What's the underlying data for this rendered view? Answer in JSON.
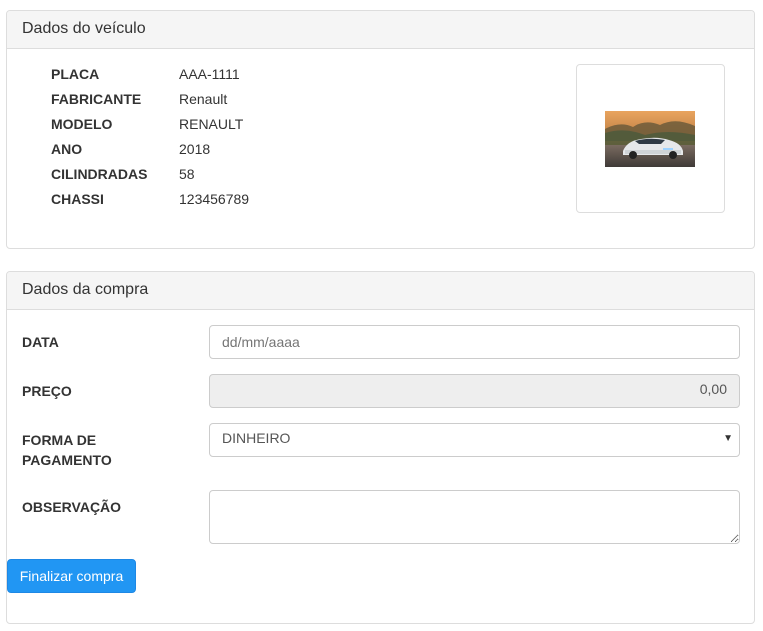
{
  "vehicle": {
    "heading": "Dados do veículo",
    "fields": [
      {
        "label": "PLACA",
        "value": "AAA-1111"
      },
      {
        "label": "FABRICANTE",
        "value": "Renault"
      },
      {
        "label": "MODELO",
        "value": "RENAULT"
      },
      {
        "label": "ANO",
        "value": "2018"
      },
      {
        "label": "CILINDRADAS",
        "value": "58"
      },
      {
        "label": "CHASSI",
        "value": "123456789"
      }
    ]
  },
  "purchase": {
    "heading": "Dados da compra",
    "date": {
      "label": "DATA",
      "placeholder": "dd/mm/aaaa"
    },
    "price": {
      "label": "PREÇO",
      "value": "0,00"
    },
    "payment": {
      "label_line1": "FORMA DE",
      "label_line2": "PAGAMENTO",
      "selected": "DINHEIRO"
    },
    "notes": {
      "label": "OBSERVAÇÃO",
      "value": ""
    },
    "submit_label": "Finalizar compra"
  },
  "colors": {
    "primary_button": "#2196f3",
    "panel_heading_bg": "#f5f5f5",
    "readonly_bg": "#eeeeee"
  }
}
